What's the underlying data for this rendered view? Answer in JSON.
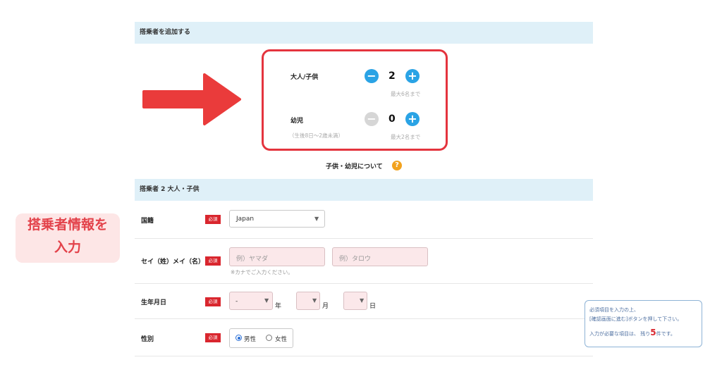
{
  "add_section": {
    "title": "搭乗者を追加する"
  },
  "counters": {
    "adult": {
      "label": "大人/子供",
      "value": "2",
      "max_note": "最大6名まで",
      "minus": "−",
      "plus": "+"
    },
    "infant": {
      "label": "幼児",
      "sub_label": "（生後8日〜2歳未満）",
      "value": "0",
      "max_note": "最大2名まで",
      "minus": "−",
      "plus": "+"
    }
  },
  "help_link": {
    "text": "子供・幼児について",
    "icon": "?"
  },
  "passenger_section": {
    "title": "搭乗者 2 大人・子供"
  },
  "required_badge": "必須",
  "form": {
    "nationality": {
      "label": "国籍",
      "value": "Japan"
    },
    "name": {
      "label": "セイ（姓）メイ（名）",
      "sei_placeholder": "例）ヤマダ",
      "mei_placeholder": "例）タロウ",
      "note": "※カナでご入力ください。"
    },
    "birthdate": {
      "label": "生年月日",
      "year_value": "-",
      "year_unit": "年",
      "month_unit": "月",
      "day_unit": "日"
    },
    "gender": {
      "label": "性別",
      "male": "男性",
      "female": "女性"
    }
  },
  "side_annotation": {
    "line1": "搭乗者情報を",
    "line2": "入力"
  },
  "notice": {
    "line1": "必須項目を入力の上、",
    "line2": "[確認画面に進む]ボタンを押して下さい。",
    "line3_prefix": "入力が必要な項目は、 残り",
    "remaining": "5",
    "line3_suffix": "件です。"
  },
  "colors": {
    "accent_blue": "#2aa3e5",
    "required_red": "#d9262e",
    "highlight_red": "#e4343e",
    "header_bg": "#dff0f8"
  }
}
